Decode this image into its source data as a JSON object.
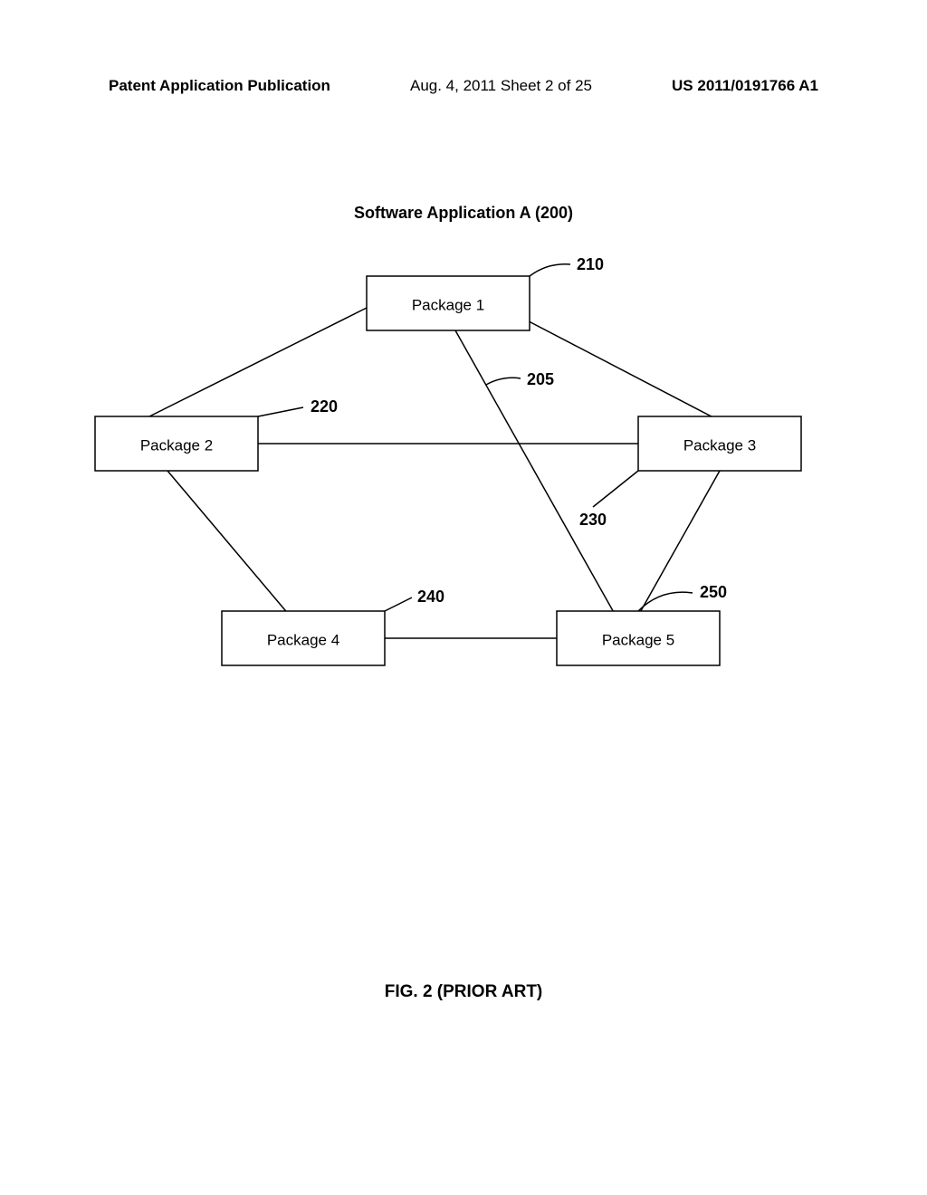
{
  "header": {
    "left": "Patent Application Publication",
    "center": "Aug. 4, 2011  Sheet 2 of 25",
    "right": "US 2011/0191766 A1"
  },
  "diagram": {
    "title": "Software Application A (200)",
    "nodes": {
      "p1": {
        "label": "Package 1",
        "ref": "210"
      },
      "p2": {
        "label": "Package 2",
        "ref": "220"
      },
      "p3": {
        "label": "Package 3",
        "ref": "230"
      },
      "p4": {
        "label": "Package 4",
        "ref": "240"
      },
      "p5": {
        "label": "Package 5",
        "ref": "250"
      }
    },
    "edge_ref": "205"
  },
  "figure_caption": "FIG. 2 (PRIOR ART)"
}
